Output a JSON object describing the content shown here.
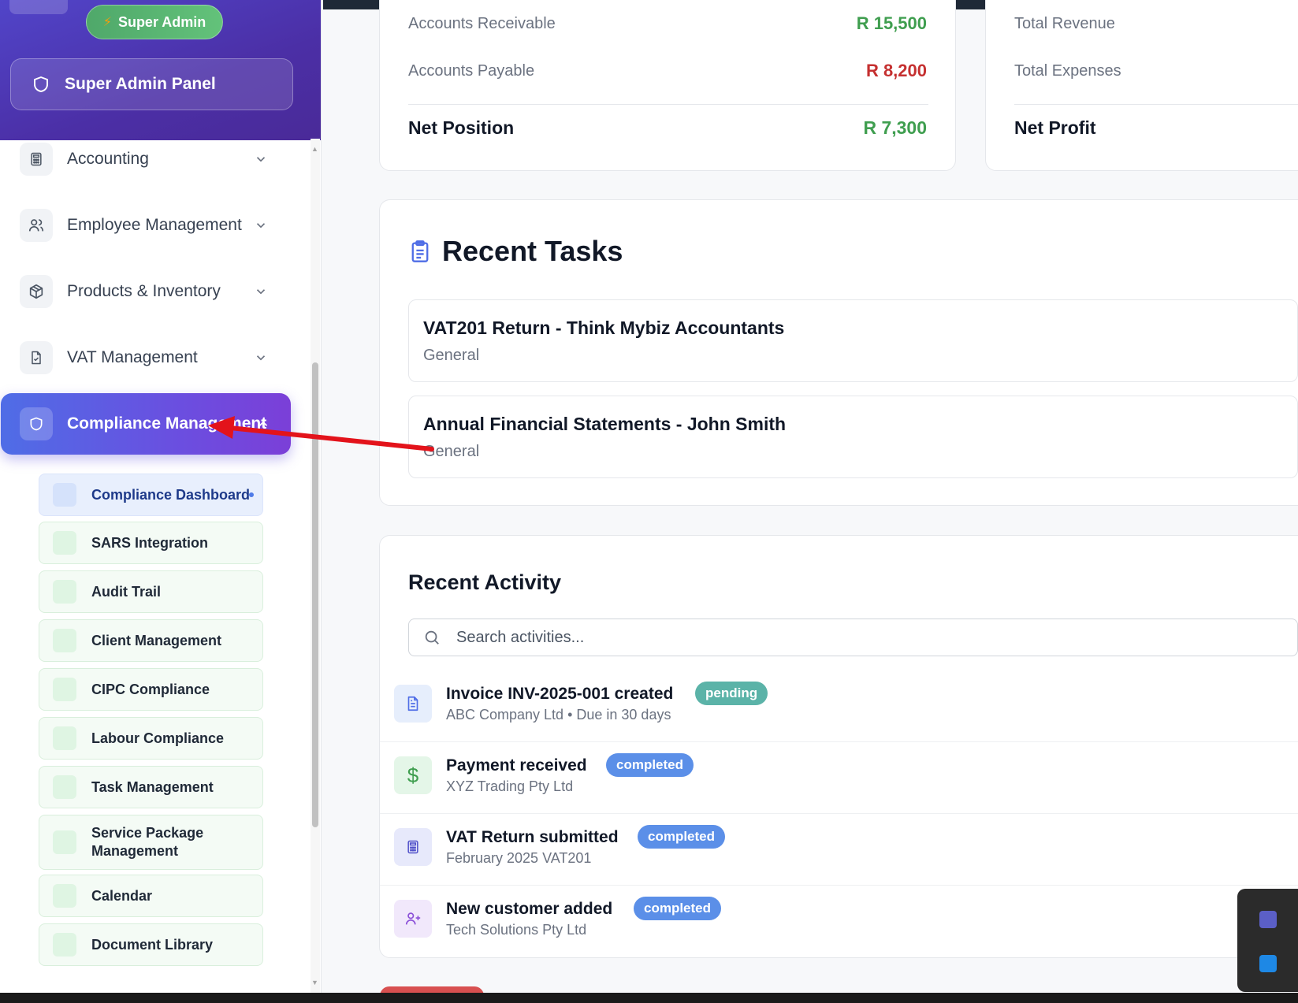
{
  "sidebar": {
    "super_admin_badge": "Super Admin",
    "admin_panel_label": "Super Admin Panel",
    "nav_items": [
      {
        "label": "Accounting",
        "icon": "calculator-icon"
      },
      {
        "label": "Employee Management",
        "icon": "users-icon"
      },
      {
        "label": "Products & Inventory",
        "icon": "box-icon"
      },
      {
        "label": "VAT Management",
        "icon": "file-check-icon"
      }
    ],
    "active_item": {
      "label": "Compliance Management",
      "icon": "shield-icon"
    },
    "sub_items": [
      {
        "label": "Compliance Dashboard",
        "active": true
      },
      {
        "label": "SARS Integration"
      },
      {
        "label": "Audit Trail"
      },
      {
        "label": "Client Management"
      },
      {
        "label": "CIPC Compliance"
      },
      {
        "label": "Labour Compliance"
      },
      {
        "label": "Task Management"
      },
      {
        "label": "Service Package Management"
      },
      {
        "label": "Calendar"
      },
      {
        "label": "Document Library"
      }
    ]
  },
  "balance_card": {
    "receivable_label": "Accounts Receivable",
    "receivable_value": "R 15,500",
    "payable_label": "Accounts Payable",
    "payable_value": "R 8,200",
    "net_label": "Net Position",
    "net_value": "R 7,300"
  },
  "pnl_card": {
    "revenue_label": "Total Revenue",
    "expenses_label": "Total Expenses",
    "net_label": "Net Profit"
  },
  "recent_tasks": {
    "title": "Recent Tasks",
    "items": [
      {
        "title": "VAT201 Return - Think Mybiz Accountants",
        "category": "General"
      },
      {
        "title": "Annual Financial Statements - John Smith",
        "category": "General"
      }
    ]
  },
  "recent_activity": {
    "title": "Recent Activity",
    "search_placeholder": "Search activities...",
    "items": [
      {
        "title": "Invoice INV-2025-001 created",
        "subtitle": "ABC Company Ltd • Due in 30 days",
        "status": "pending",
        "icon": "file-text-icon"
      },
      {
        "title": "Payment received",
        "subtitle": "XYZ Trading Pty Ltd",
        "status": "completed",
        "icon": "dollar-icon"
      },
      {
        "title": "VAT Return submitted",
        "subtitle": "February 2025 VAT201",
        "status": "completed",
        "icon": "calculator-icon"
      },
      {
        "title": "New customer added",
        "subtitle": "Tech Solutions Pty Ltd",
        "status": "completed",
        "icon": "user-plus-icon"
      }
    ]
  },
  "colors": {
    "positive": "#3f9e4f",
    "negative": "#c53030",
    "accent": "#5b57e0",
    "pending": "#5bb3a8",
    "completed": "#5b8fe8",
    "annotation_arrow": "#e3131b"
  }
}
